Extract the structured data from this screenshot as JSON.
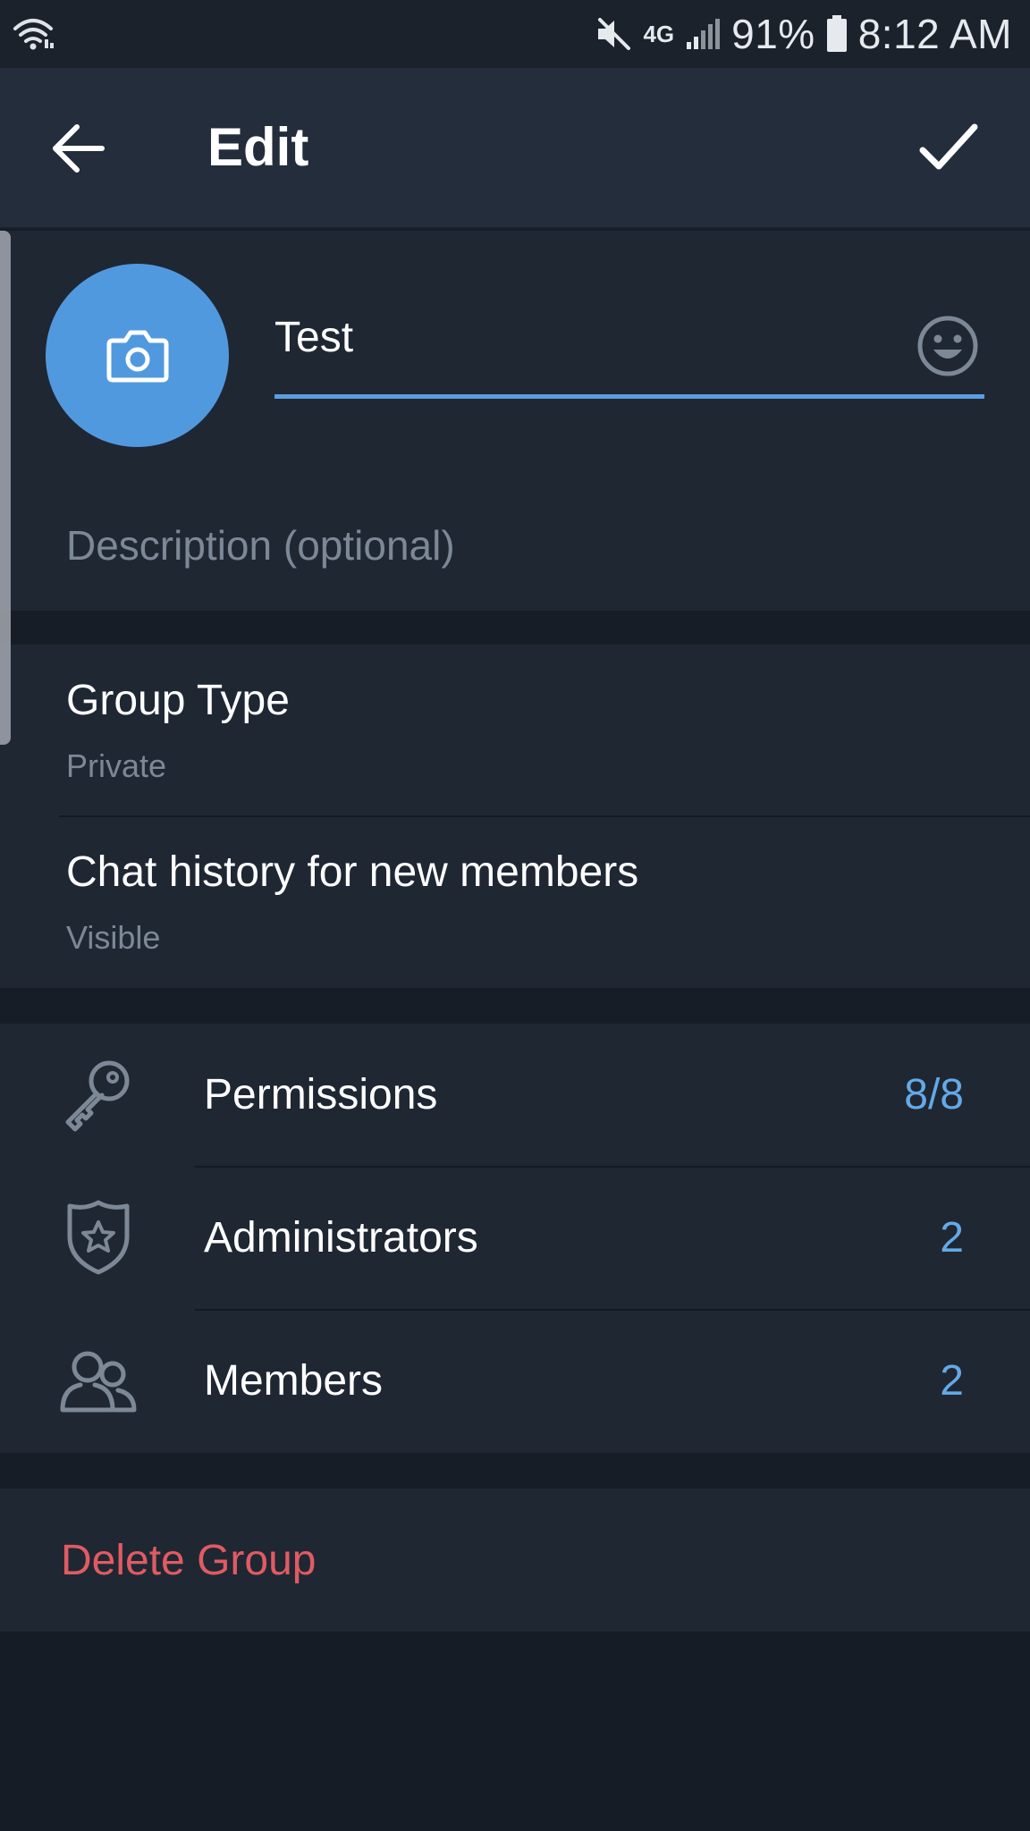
{
  "status_bar": {
    "battery": "91%",
    "time": "8:12 AM",
    "network": "4G",
    "icons": [
      "wifi-icon",
      "mute-icon",
      "network-4g-icon",
      "signal-icon",
      "battery-icon"
    ]
  },
  "app_bar": {
    "title": "Edit",
    "back_icon": "arrow-left-icon",
    "done_icon": "check-icon"
  },
  "profile": {
    "avatar_icon": "camera-icon",
    "name_value": "Test",
    "emoji_icon": "smile-icon",
    "description_placeholder": "Description (optional)"
  },
  "group_settings": [
    {
      "title": "Group Type",
      "value": "Private"
    },
    {
      "title": "Chat history for new members",
      "value": "Visible"
    }
  ],
  "management": [
    {
      "icon": "key-icon",
      "label": "Permissions",
      "count": "8/8"
    },
    {
      "icon": "admin-badge-icon",
      "label": "Administrators",
      "count": "2"
    },
    {
      "icon": "members-icon",
      "label": "Members",
      "count": "2"
    }
  ],
  "danger": {
    "delete_label": "Delete Group"
  },
  "colors": {
    "accent": "#5199df",
    "count_blue": "#64a9e8",
    "danger_red": "#e05b62",
    "background": "#1f2733",
    "app_bar": "#232d3c"
  }
}
